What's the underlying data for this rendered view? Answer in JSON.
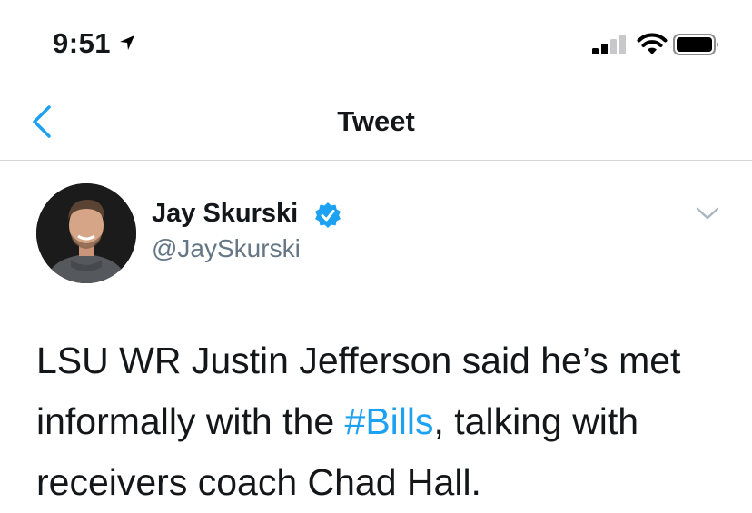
{
  "status_bar": {
    "time": "9:51",
    "icons": [
      "location-arrow-icon",
      "cellular-signal-icon",
      "wifi-icon",
      "battery-icon"
    ]
  },
  "nav": {
    "title": "Tweet",
    "back_icon": "chevron-left-icon"
  },
  "tweet": {
    "author_name": "Jay Skurski",
    "author_handle": "@JaySkurski",
    "verified": true,
    "text_before": "LSU WR Justin Jefferson said he’s met informally with the ",
    "hashtag": "#Bills",
    "text_after": ", talking with receivers coach Chad Hall."
  },
  "colors": {
    "accent": "#1da1f2",
    "text": "#14171a",
    "secondary_text": "#657786",
    "divider": "#d3d6d9"
  }
}
